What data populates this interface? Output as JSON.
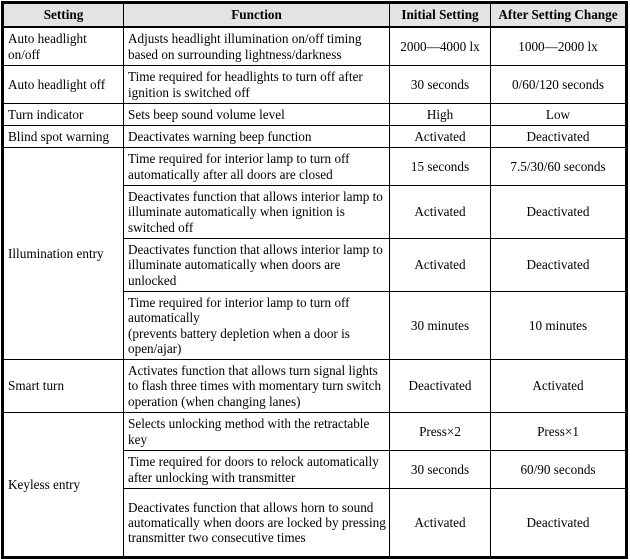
{
  "table": {
    "headers": [
      {
        "label": "Setting",
        "key": "setting"
      },
      {
        "label": "Function",
        "key": "function"
      },
      {
        "label": "Initial Setting",
        "key": "initial"
      },
      {
        "label": "After Setting Change",
        "key": "after"
      }
    ],
    "header_background": "#e3e3e3",
    "border_color": "#000000",
    "rows": [
      {
        "setting": "Auto headlight on/off",
        "function": "Adjusts headlight illumination on/off timing based on surrounding lightness/darkness",
        "initial": "2000—4000 lx",
        "after": "1000—2000 lx"
      },
      {
        "setting": "Auto headlight off",
        "function": "Time required for headlights to turn off after ignition is switched off",
        "initial": "30 seconds",
        "after": "0/60/120 seconds"
      },
      {
        "setting": "Turn indicator",
        "function": "Sets beep sound volume level",
        "initial": "High",
        "after": "Low"
      },
      {
        "setting": "Blind spot warning",
        "function": "Deactivates warning beep function",
        "initial": "Activated",
        "after": "Deactivated"
      },
      {
        "setting": "Illumination entry",
        "function": "Time required for interior lamp to turn off automatically after all doors are closed",
        "initial": "15 seconds",
        "after": "7.5/30/60 seconds"
      },
      {
        "setting": "",
        "function": "Deactivates function that allows interior lamp to illuminate automatically when ignition is switched off",
        "initial": "Activated",
        "after": "Deactivated"
      },
      {
        "setting": "",
        "function": "Deactivates function that allows interior lamp to illuminate automatically when doors are unlocked",
        "initial": "Activated",
        "after": "Deactivated"
      },
      {
        "setting": "",
        "function": "Time required for interior lamp to turn off automatically\n(prevents battery depletion when a door is open/ajar)",
        "initial": "30 minutes",
        "after": "10 minutes"
      },
      {
        "setting": "Smart turn",
        "function": "Activates function that allows turn signal lights to flash three times with momentary turn switch operation (when changing lanes)",
        "initial": "Deactivated",
        "after": "Activated"
      },
      {
        "setting": "Keyless entry",
        "function": "Selects unlocking method with the retractable key",
        "initial": "Press×2",
        "after": "Press×1"
      },
      {
        "setting": "",
        "function": "Time required for doors to relock automatically after unlocking with transmitter",
        "initial": "30 seconds",
        "after": "60/90 seconds"
      },
      {
        "setting": "",
        "function": "Deactivates function that allows horn to sound automatically when doors are locked by pressing transmitter two consecutive times",
        "initial": "Activated",
        "after": "Deactivated"
      }
    ]
  }
}
